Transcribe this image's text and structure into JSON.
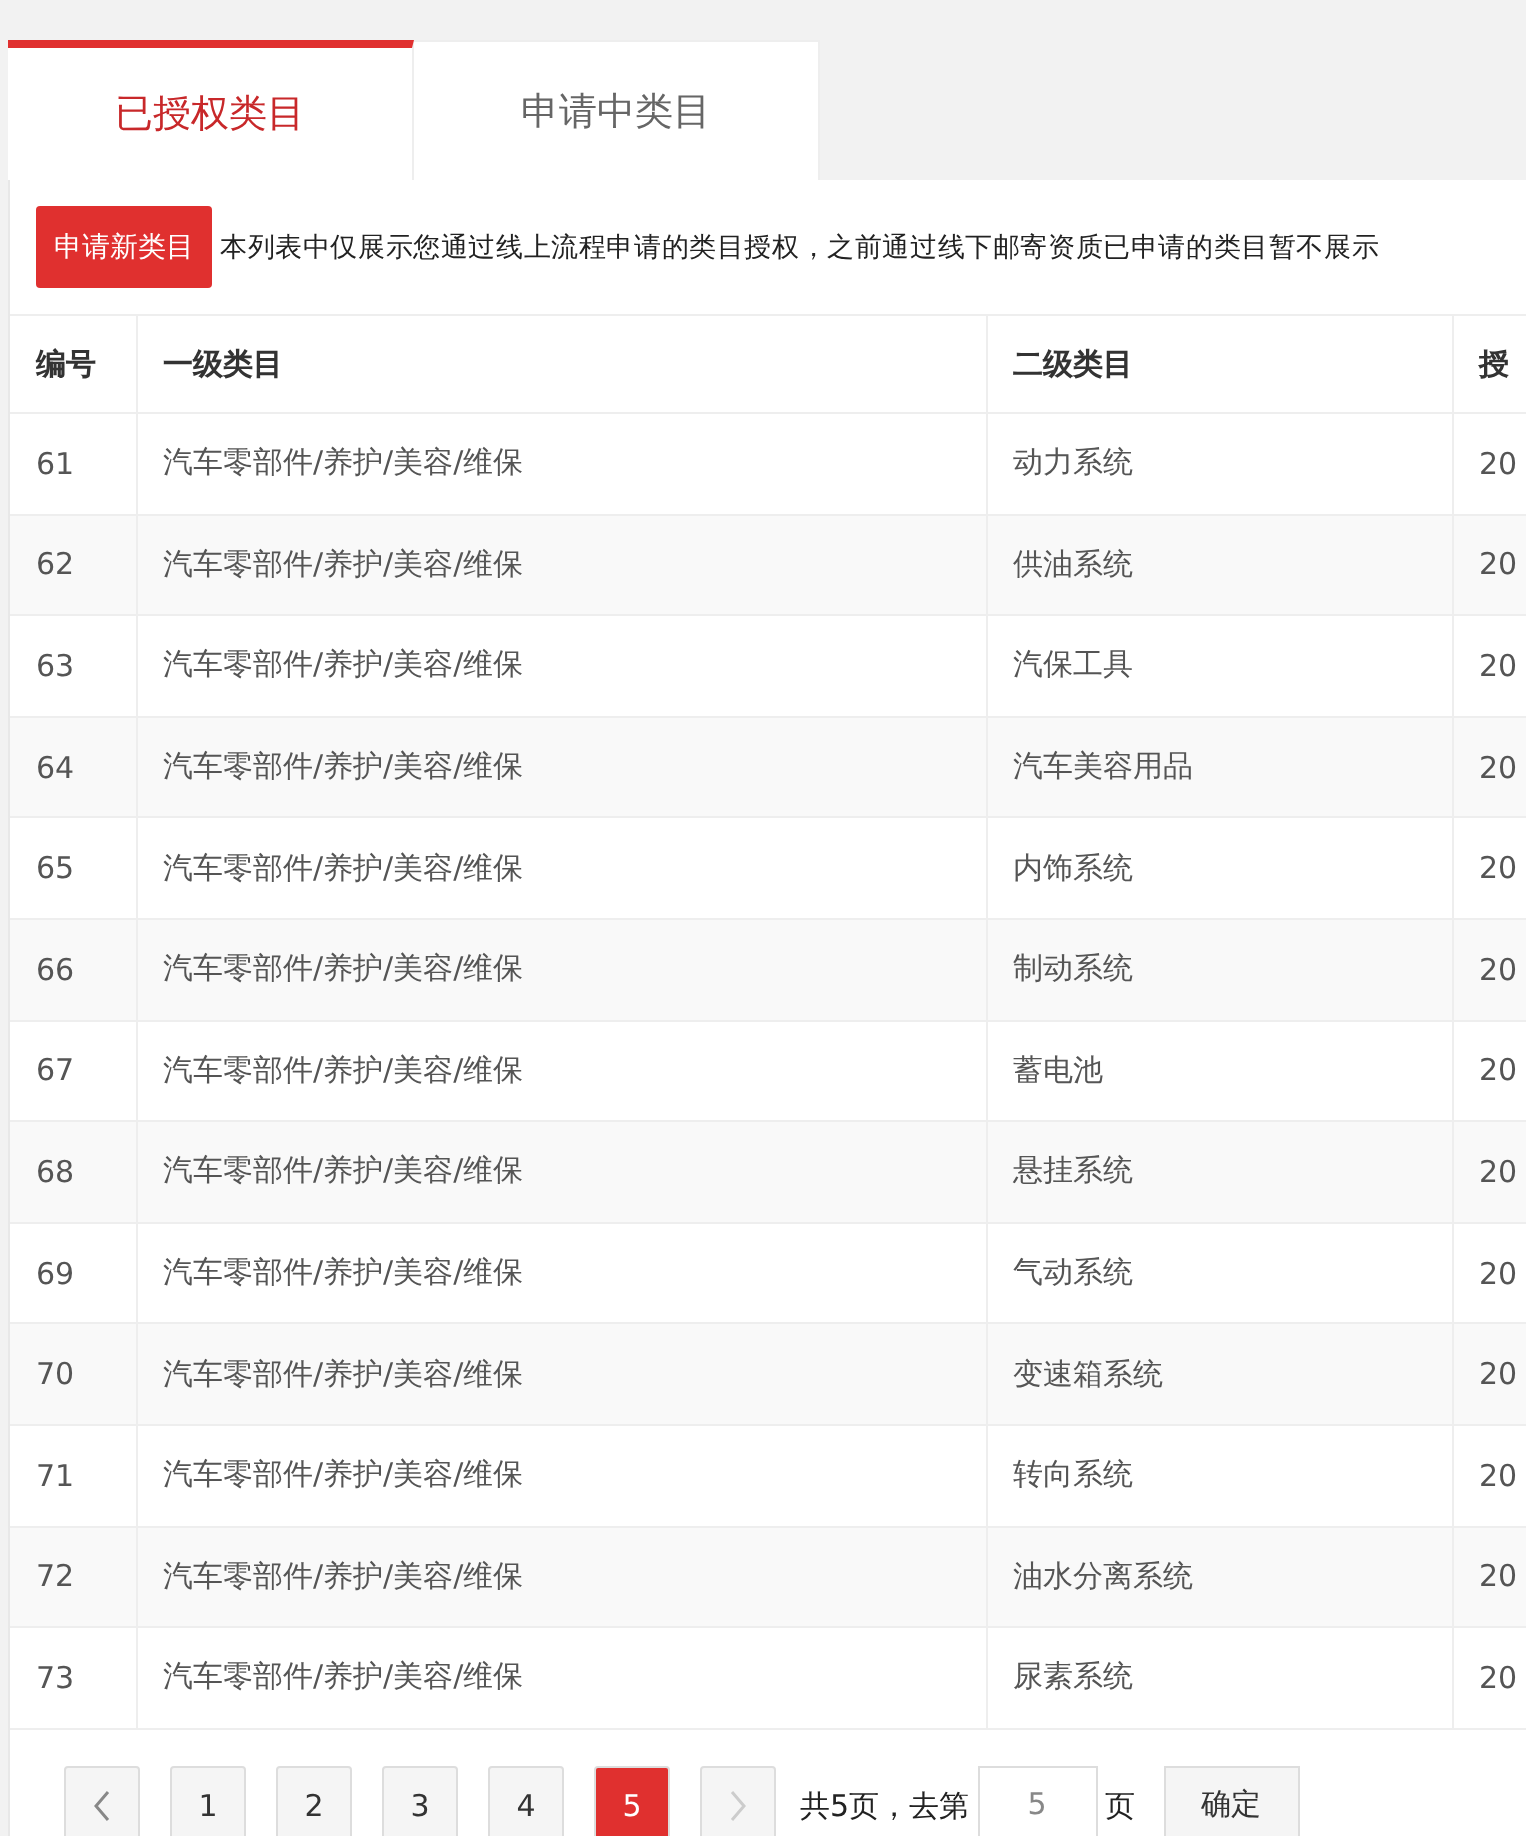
{
  "tabs": [
    {
      "label": "已授权类目",
      "selected": true
    },
    {
      "label": "申请中类目",
      "selected": false
    }
  ],
  "apply_button": "申请新类目",
  "notice": "本列表中仅展示您通过线上流程申请的类目授权，之前通过线下邮寄资质已申请的类目暂不展示",
  "table": {
    "columns": [
      "编号",
      "一级类目",
      "二级类目",
      "授"
    ],
    "rows": [
      {
        "id": "61",
        "level1": "汽车零部件/养护/美容/维保",
        "level2": "动力系统",
        "column_4": "20"
      },
      {
        "id": "62",
        "level1": "汽车零部件/养护/美容/维保",
        "level2": "供油系统",
        "column_4": "20"
      },
      {
        "id": "63",
        "level1": "汽车零部件/养护/美容/维保",
        "level2": "汽保工具",
        "column_4": "20"
      },
      {
        "id": "64",
        "level1": "汽车零部件/养护/美容/维保",
        "level2": "汽车美容用品",
        "column_4": "20"
      },
      {
        "id": "65",
        "level1": "汽车零部件/养护/美容/维保",
        "level2": "内饰系统",
        "column_4": "20"
      },
      {
        "id": "66",
        "level1": "汽车零部件/养护/美容/维保",
        "level2": "制动系统",
        "column_4": "20"
      },
      {
        "id": "67",
        "level1": "汽车零部件/养护/美容/维保",
        "level2": "蓄电池",
        "column_4": "20"
      },
      {
        "id": "68",
        "level1": "汽车零部件/养护/美容/维保",
        "level2": "悬挂系统",
        "column_4": "20"
      },
      {
        "id": "69",
        "level1": "汽车零部件/养护/美容/维保",
        "level2": "气动系统",
        "column_4": "20"
      },
      {
        "id": "70",
        "level1": "汽车零部件/养护/美容/维保",
        "level2": "变速箱系统",
        "column_4": "20"
      },
      {
        "id": "71",
        "level1": "汽车零部件/养护/美容/维保",
        "level2": "转向系统",
        "column_4": "20"
      },
      {
        "id": "72",
        "level1": "汽车零部件/养护/美容/维保",
        "level2": "油水分离系统",
        "column_4": "20"
      },
      {
        "id": "73",
        "level1": "汽车零部件/养护/美容/维保",
        "level2": "尿素系统",
        "column_4": "20"
      }
    ]
  },
  "pagination": {
    "pages": [
      {
        "label": "1",
        "selected": false
      },
      {
        "label": "2",
        "selected": false
      },
      {
        "label": "3",
        "selected": false
      },
      {
        "label": "4",
        "selected": false
      },
      {
        "label": "5",
        "selected": true
      }
    ],
    "prev_disabled": false,
    "next_disabled": true,
    "total_text": "共5页，去第",
    "goto_value": "5",
    "page_suffix": "页",
    "confirm": "确定"
  }
}
